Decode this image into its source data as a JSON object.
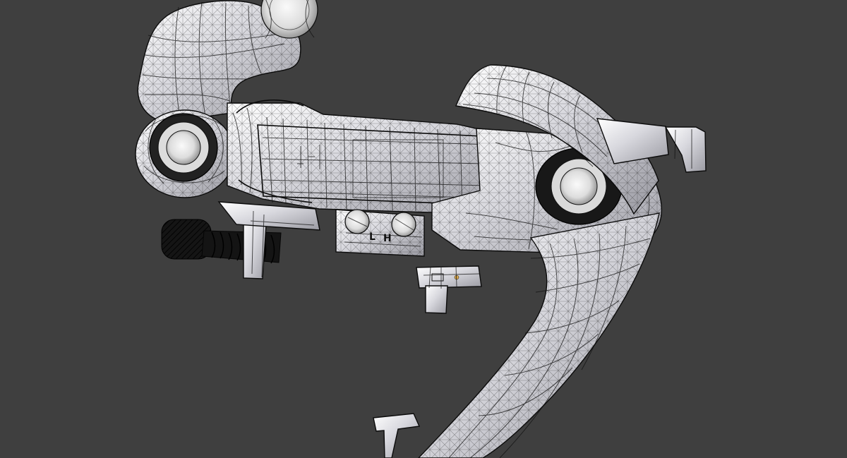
{
  "scene": {
    "background": "#3f3f3f",
    "object": "rear-derailleur-wireframe-model",
    "limit_labels": [
      "L",
      "H"
    ]
  }
}
